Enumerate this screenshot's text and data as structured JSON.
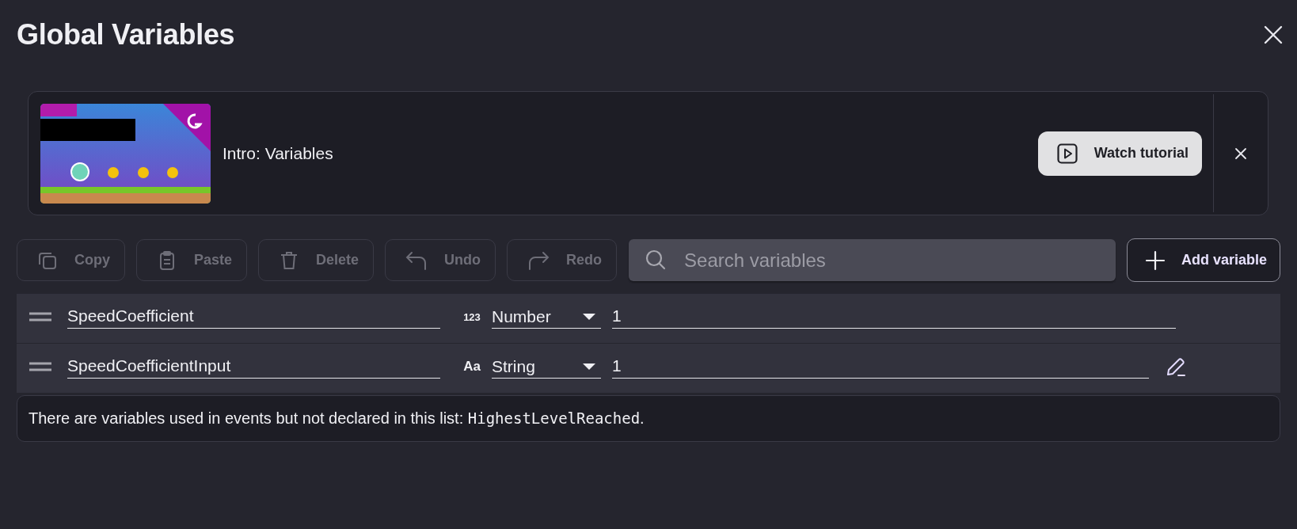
{
  "dialog": {
    "title": "Global Variables"
  },
  "tutorial": {
    "title": "Intro: Variables",
    "watch_button": "Watch tutorial"
  },
  "toolbar": {
    "buttons": [
      {
        "label": "Copy",
        "kind": "copy",
        "disabled": true
      },
      {
        "label": "Paste",
        "kind": "paste",
        "disabled": true
      },
      {
        "label": "Delete",
        "kind": "delete",
        "disabled": true
      },
      {
        "label": "Undo",
        "kind": "undo",
        "disabled": true
      },
      {
        "label": "Redo",
        "kind": "redo",
        "disabled": true
      }
    ],
    "search": {
      "placeholder": "Search variables"
    },
    "add_button": "Add variable"
  },
  "variables": [
    {
      "name": "SpeedCoefficient",
      "type_icon": "123",
      "type": "Number",
      "value": "1",
      "show_edit": false
    },
    {
      "name": "SpeedCoefficientInput",
      "type_icon": "Aa",
      "type": "String",
      "value": "1",
      "show_edit": true
    }
  ],
  "notice": {
    "text": "There are variables used in events but not declared in this list: ",
    "variables": [
      "HighestLevelReached"
    ],
    "suffix": "."
  }
}
